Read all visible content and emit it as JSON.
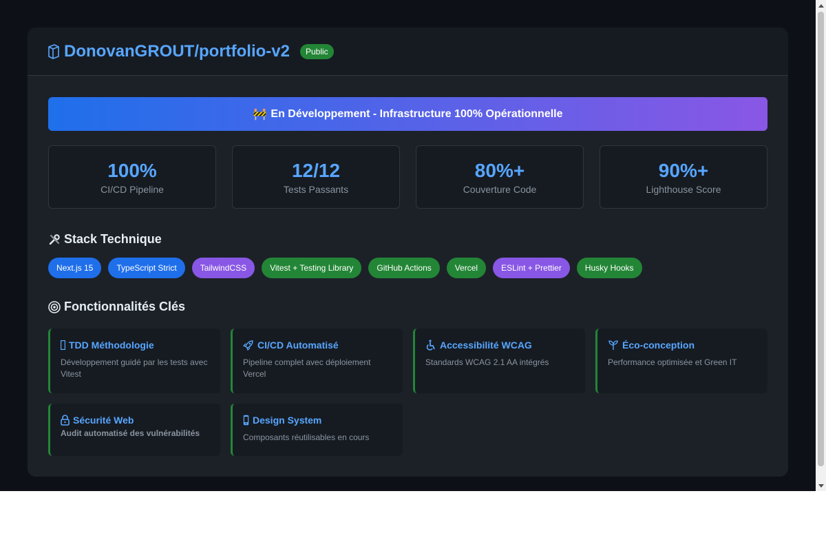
{
  "repo": {
    "title": "DonovanGROUT/portfolio-v2",
    "visibility": "Public",
    "icon": "repo-book-icon"
  },
  "banner": {
    "emoji": "🚧",
    "text": "En Développement - Infrastructure 100% Opérationnelle"
  },
  "stats": [
    {
      "value": "100%",
      "label": "CI/CD Pipeline"
    },
    {
      "value": "12/12",
      "label": "Tests Passants"
    },
    {
      "value": "80%+",
      "label": "Couverture Code"
    },
    {
      "value": "90%+",
      "label": "Lighthouse Score"
    }
  ],
  "stack": {
    "title": "Stack Technique",
    "icon": "tools-icon",
    "chips": [
      {
        "label": "Next.js 15",
        "color": "#1f6feb"
      },
      {
        "label": "TypeScript Strict",
        "color": "#1f6feb"
      },
      {
        "label": "TailwindCSS",
        "color": "#8957e5"
      },
      {
        "label": "Vitest + Testing Library",
        "color": "#238636"
      },
      {
        "label": "GitHub Actions",
        "color": "#238636"
      },
      {
        "label": "Vercel",
        "color": "#238636"
      },
      {
        "label": "ESLint + Prettier",
        "color": "#8957e5"
      },
      {
        "label": "Husky Hooks",
        "color": "#238636"
      }
    ]
  },
  "features": {
    "title": "Fonctionnalités Clés",
    "icon": "target-icon",
    "items": [
      {
        "title": "TDD Méthodologie",
        "desc": "Développement guidé par les tests avec Vitest",
        "icon": "missing-glyph-icon"
      },
      {
        "title": "CI/CD Automatisé",
        "desc": "Pipeline complet avec déploiement Vercel",
        "icon": "rocket-icon"
      },
      {
        "title": "Accessibilité WCAG",
        "desc": "Standards WCAG 2.1 AA intégrés",
        "icon": "wheelchair-icon"
      },
      {
        "title": "Éco-conception",
        "desc": "Performance optimisée et Green IT",
        "icon": "seedling-icon"
      },
      {
        "title": "Sécurité Web",
        "desc": "Audit automatisé des vulnérabilités",
        "icon": "lock-icon"
      },
      {
        "title": "Design System",
        "desc": "Composants réutilisables en cours",
        "icon": "phone-icon"
      }
    ]
  },
  "colors": {
    "accent": "#58a6ff",
    "green": "#238636",
    "purple": "#8957e5",
    "blue": "#1f6feb",
    "background": "#0d1117"
  }
}
